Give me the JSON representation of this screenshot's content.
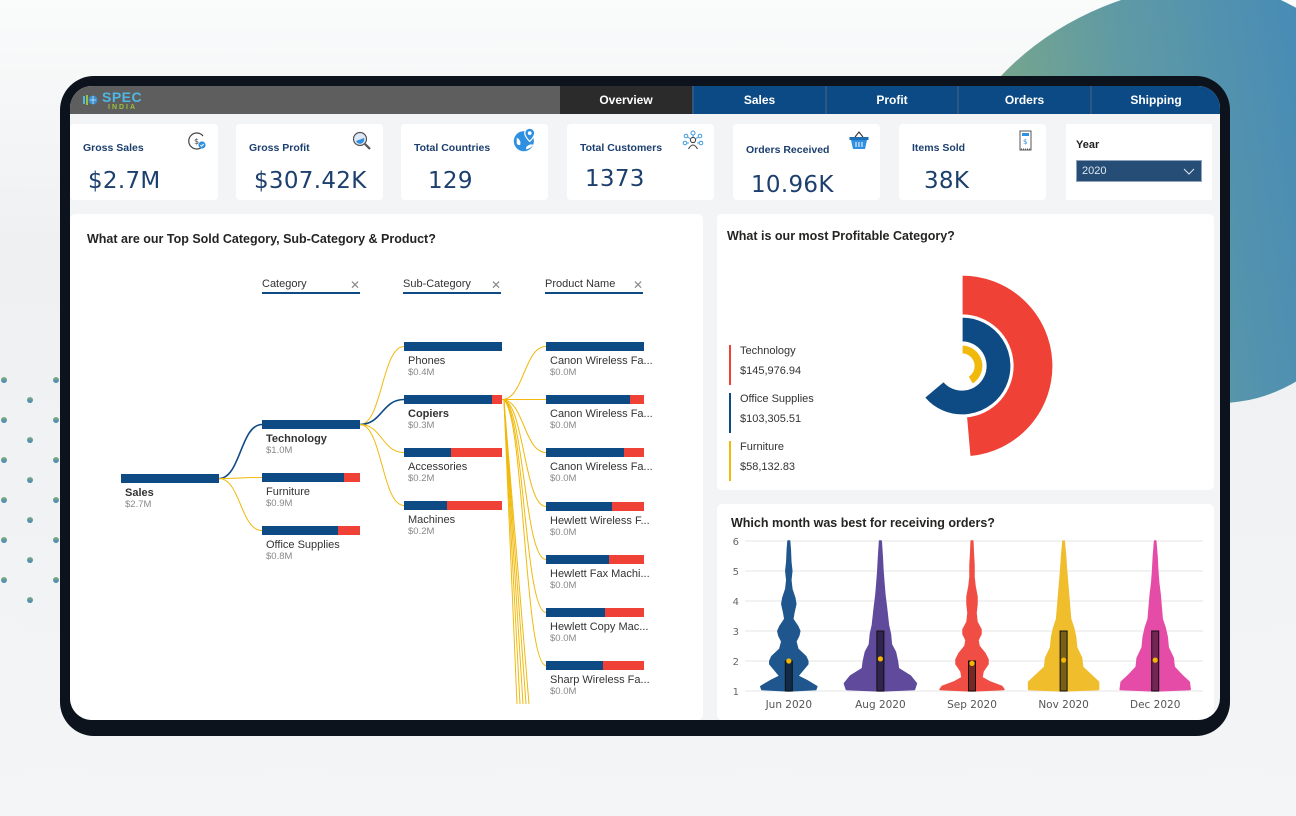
{
  "brand": {
    "logo_top": "SPEC",
    "logo_bottom": "INDIA"
  },
  "nav": {
    "tabs": [
      {
        "label": "Overview",
        "active": true
      },
      {
        "label": "Sales",
        "active": false
      },
      {
        "label": "Profit",
        "active": false
      },
      {
        "label": "Orders",
        "active": false
      },
      {
        "label": "Shipping",
        "active": false
      }
    ]
  },
  "kpis": [
    {
      "title": "Gross Sales",
      "value": "$2.7M",
      "icon": "dollar-check-icon"
    },
    {
      "title": "Gross Profit",
      "value": "$307.42K",
      "icon": "magnifier-profit-icon"
    },
    {
      "title": "Total Countries",
      "value": "129",
      "icon": "globe-pin-icon"
    },
    {
      "title": "Total Customers",
      "value": "1373",
      "icon": "customer-network-icon"
    },
    {
      "title": "Orders Received",
      "value": "10.96K",
      "icon": "basket-icon"
    },
    {
      "title": "Items Sold",
      "value": "38K",
      "icon": "receipt-icon"
    }
  ],
  "year_filter": {
    "label": "Year",
    "selected": "2020"
  },
  "colors": {
    "navy": "#0e4a84",
    "red": "#ef4136",
    "yellow": "#f0b90b",
    "purple": "#5f3f98",
    "pink": "#e44ca8",
    "gold": "#f0bd2c"
  },
  "decomposition_tree": {
    "title": "What are our Top Sold Category, Sub-Category & Product?",
    "level_headers": [
      "Category",
      "Sub-Category",
      "Product Name"
    ],
    "root": {
      "label": "Sales",
      "value": "$2.7M",
      "share": 1.0
    },
    "categories": [
      {
        "label": "Technology",
        "value": "$1.0M",
        "share": 1.0,
        "expanded": true
      },
      {
        "label": "Furniture",
        "value": "$0.9M",
        "share": 0.84
      },
      {
        "label": "Office Supplies",
        "value": "$0.8M",
        "share": 0.78
      }
    ],
    "subcategories": [
      {
        "label": "Phones",
        "value": "$0.4M",
        "share": 1.0
      },
      {
        "label": "Copiers",
        "value": "$0.3M",
        "share": 0.9,
        "expanded": true
      },
      {
        "label": "Accessories",
        "value": "$0.2M",
        "share": 0.48
      },
      {
        "label": "Machines",
        "value": "$0.2M",
        "share": 0.44
      }
    ],
    "products": [
      {
        "label": "Canon Wireless Fa...",
        "value": "$0.0M",
        "share": 1.0
      },
      {
        "label": "Canon Wireless Fa...",
        "value": "$0.0M",
        "share": 0.86
      },
      {
        "label": "Canon Wireless Fa...",
        "value": "$0.0M",
        "share": 0.8
      },
      {
        "label": "Hewlett Wireless F...",
        "value": "$0.0M",
        "share": 0.67
      },
      {
        "label": "Hewlett Fax Machi...",
        "value": "$0.0M",
        "share": 0.64
      },
      {
        "label": "Hewlett Copy Mac...",
        "value": "$0.0M",
        "share": 0.6
      },
      {
        "label": "Sharp Wireless Fa...",
        "value": "$0.0M",
        "share": 0.58
      }
    ]
  },
  "chart_data": [
    {
      "type": "radial-bar",
      "title": "What is our most Profitable Category?",
      "legend_position": "left",
      "categories": [
        "Technology",
        "Office Supplies",
        "Furniture"
      ],
      "values": [
        145976.94,
        103305.51,
        58132.83
      ],
      "value_labels": [
        "$145,976.94",
        "$103,305.51",
        "$58,132.83"
      ],
      "colors": [
        "#ef4136",
        "#0e4a84",
        "#f0b90b"
      ],
      "sweep_degrees": [
        175,
        230,
        150
      ]
    },
    {
      "type": "violin",
      "title": "Which month was best for receiving orders?",
      "categories": [
        "Jun 2020",
        "Aug 2020",
        "Sep 2020",
        "Nov 2020",
        "Dec 2020"
      ],
      "ylim": [
        1,
        6
      ],
      "yticks": [
        1,
        2,
        3,
        4,
        5,
        6
      ],
      "grid": true,
      "series": [
        {
          "name": "Jun 2020",
          "color": "#1f568e",
          "q1": 1,
          "q3": 2,
          "mean": 2.0,
          "max": 6
        },
        {
          "name": "Aug 2020",
          "color": "#5f4a9c",
          "q1": 1,
          "q3": 3,
          "mean": 2.07,
          "max": 6
        },
        {
          "name": "Sep 2020",
          "color": "#f04e45",
          "q1": 1,
          "q3": 2,
          "mean": 1.92,
          "max": 6
        },
        {
          "name": "Nov 2020",
          "color": "#f0bd2c",
          "q1": 1,
          "q3": 3,
          "mean": 2.03,
          "max": 6
        },
        {
          "name": "Dec 2020",
          "color": "#e44ca8",
          "q1": 1,
          "q3": 3,
          "mean": 2.03,
          "max": 6
        }
      ]
    }
  ]
}
